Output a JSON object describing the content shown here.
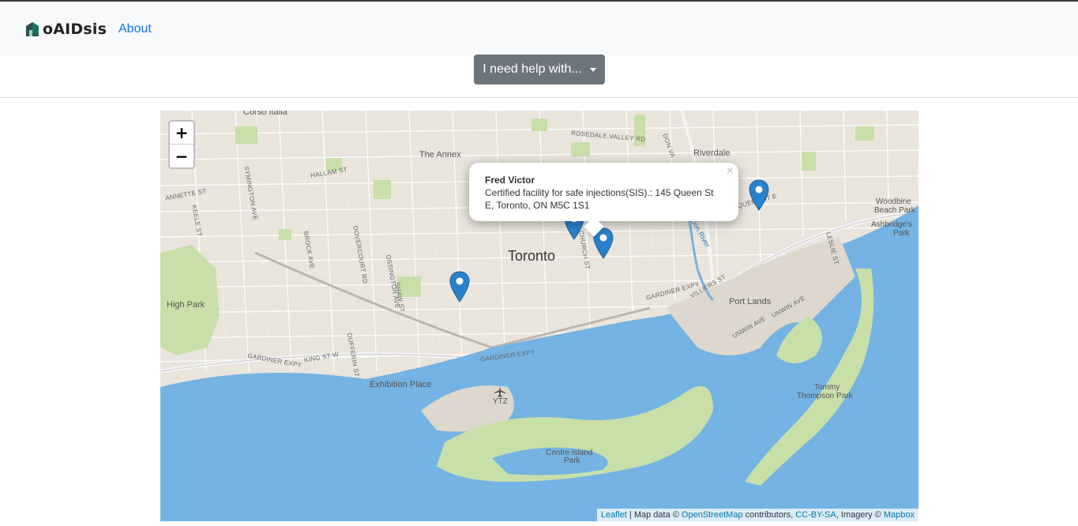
{
  "navbar": {
    "brand": "oAIDsis",
    "about_link": "About"
  },
  "help_button": {
    "label": "I need help with..."
  },
  "map": {
    "zoom_in": "+",
    "zoom_out": "−",
    "labels": {
      "city": "Toronto",
      "the_annex": "The Annex",
      "riverdale": "Riverdale",
      "high_park": "High Park",
      "exhibition_place": "Exhibition Place",
      "port_lands": "Port Lands",
      "woodbine": "Woodbine",
      "beach_park": "Beach Park",
      "ashbridges": "Ashbridge's",
      "park": "Park",
      "tommy": "Tommy",
      "thompson_park": "Thompson Park",
      "centre_island": "Centre Island",
      "centre_island_park": "Park",
      "ytz": "YTZ",
      "corso_italia": "Corso Italia",
      "rosedale_valley": "ROSEDALE VALLEY RD",
      "queen_st_e": "QUEEN ST E",
      "gardiner_expy": "GARDINER EXPY",
      "king_st_w": "KING ST W",
      "church_st": "CHURCH ST",
      "annette_st": "ANNETTE ST",
      "hallam_st": "HALLAM ST",
      "symington_ave": "SYMINGTON AVE",
      "keele_st": "KEELE ST",
      "brock_ave": "BROCK AVE",
      "dovercourt_rd": "DOVERCOURT RD",
      "ossington_ave": "OSSINGTON AVE",
      "shaw_st": "SHAW ST",
      "dufferin_st": "DUFFERIN ST",
      "villiers_st": "VILLIERS ST",
      "unwin_ave": "UNWIN AVE",
      "leslie_st": "LESLIE ST",
      "don_valley": "DON VA",
      "don_river": "Don River"
    },
    "popup": {
      "title": "Fred Victor",
      "body": "Certified facility for safe injections(SIS).: 145 Queen St E, Toronto, ON M5C 1S1",
      "close": "×"
    },
    "attribution": {
      "leaflet": "Leaflet",
      "sep1": " | Map data © ",
      "osm": "OpenStreetMap",
      "contributors": " contributors, ",
      "license": "CC-BY-SA",
      "imagery": ", Imagery © ",
      "mapbox": "Mapbox"
    },
    "colors": {
      "water": "#74b3e3",
      "land": "#e9e4dc",
      "park": "#c8dfa8",
      "marker": "#2a81cb"
    }
  }
}
